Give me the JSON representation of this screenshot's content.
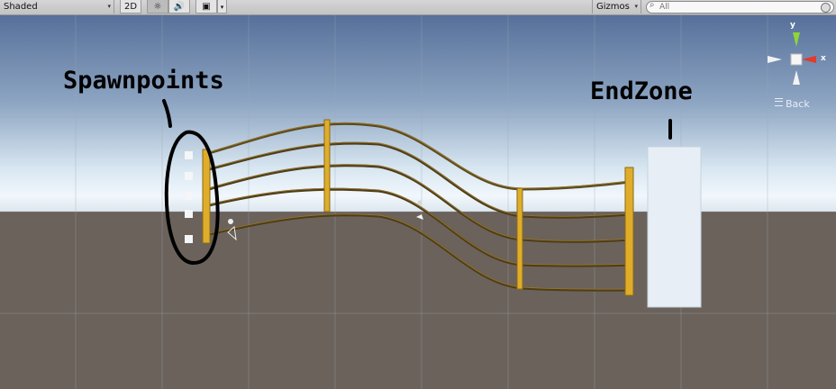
{
  "toolbar": {
    "shading_mode": "Shaded",
    "mode_2d": "2D",
    "lighting_icon": "sun-icon",
    "audio_icon": "speaker-icon",
    "effects_icon": "image-icon",
    "gizmos": "Gizmos",
    "search_placeholder": "All"
  },
  "orientation_gizmo": {
    "y_label": "y",
    "x_label": "x",
    "back_label": "Back",
    "colors": {
      "y": "#8fd43a",
      "x": "#e23b2a",
      "neutral": "#f2f2f2"
    }
  },
  "annotations": {
    "spawnpoints": "Spawnpoints",
    "endzone": "EndZone"
  },
  "colors": {
    "sky_top": "#5a7295",
    "sky_horizon": "#eef5fb",
    "ground": "#6b625b",
    "rail": "#5c4a20",
    "post": "#e2b02c",
    "endzone_box": "#e6eef5"
  }
}
